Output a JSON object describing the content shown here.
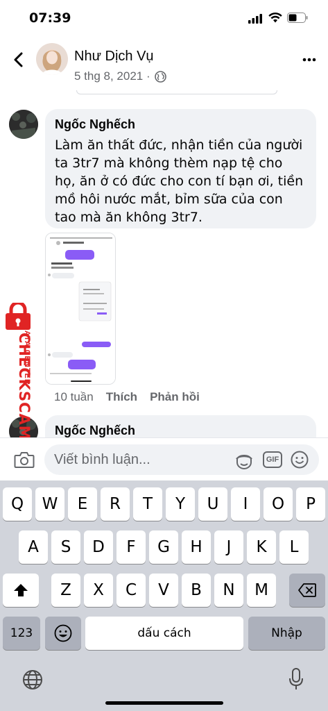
{
  "status_bar": {
    "time": "07:39"
  },
  "header": {
    "name": "Như Dịch Vụ",
    "date": "5 thg 8, 2021 ·"
  },
  "comment": {
    "author": "Ngốc Nghếch",
    "text": "Làm ăn thất đức, nhận tiền của người ta 3tr7 mà không thèm nạp tệ cho họ, ăn ở có đức cho con tí bạn ơi, tiền mồ hôi nước mắt, bỉm sữa của con tao mà ăn không 3tr7.",
    "time": "10 tuần",
    "like_label": "Thích",
    "reply_label": "Phản hồi"
  },
  "comment2": {
    "author": "Ngốc Nghếch"
  },
  "watermark": {
    "big": "CHECKSCAM.INFO",
    "small": "DATA CENTER"
  },
  "composer": {
    "placeholder": "Viết bình luận...",
    "gif_label": "GIF"
  },
  "keyboard": {
    "row1": [
      "Q",
      "W",
      "E",
      "R",
      "T",
      "Y",
      "U",
      "I",
      "O",
      "P"
    ],
    "row2": [
      "A",
      "S",
      "D",
      "F",
      "G",
      "H",
      "J",
      "K",
      "L"
    ],
    "row3": [
      "Z",
      "X",
      "C",
      "V",
      "B",
      "N",
      "M"
    ],
    "numbers_label": "123",
    "space_label": "dấu cách",
    "return_label": "Nhập"
  },
  "colors": {
    "secondary_text": "#65676b",
    "bubble": "#f0f2f5",
    "keyboard_bg": "#d1d4db",
    "watermark": "#e02424",
    "messenger_purple": "#8a5cf6"
  }
}
